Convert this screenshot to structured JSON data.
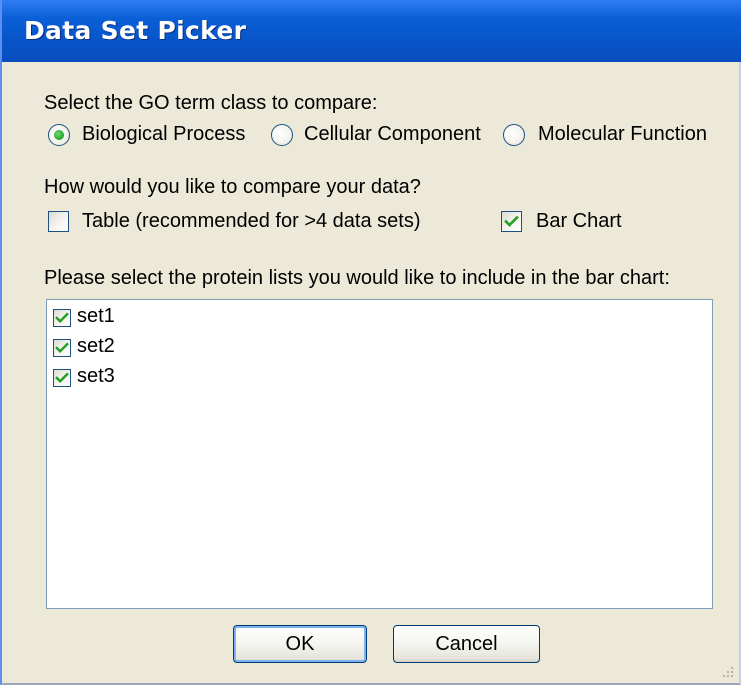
{
  "window": {
    "title": "Data Set Picker"
  },
  "go_class": {
    "prompt": "Select the GO term class to compare:",
    "options": [
      {
        "label": "Biological Process",
        "selected": true
      },
      {
        "label": "Cellular Component",
        "selected": false
      },
      {
        "label": "Molecular Function",
        "selected": false
      }
    ]
  },
  "compare": {
    "prompt": "How would you like to compare your data?",
    "table": {
      "label": "Table (recommended for >4 data sets)",
      "checked": false
    },
    "bar_chart": {
      "label": "Bar Chart",
      "checked": true
    }
  },
  "protein_lists": {
    "prompt": "Please select the protein lists you would like to include in the bar chart:",
    "items": [
      {
        "label": "set1",
        "checked": true
      },
      {
        "label": "set2",
        "checked": true
      },
      {
        "label": "set3",
        "checked": true
      }
    ]
  },
  "buttons": {
    "ok_label": "OK",
    "cancel_label": "Cancel"
  },
  "colors": {
    "title_bar": "#0753c8",
    "dialog_bg": "#ece9d8",
    "check_green": "#21a121"
  }
}
